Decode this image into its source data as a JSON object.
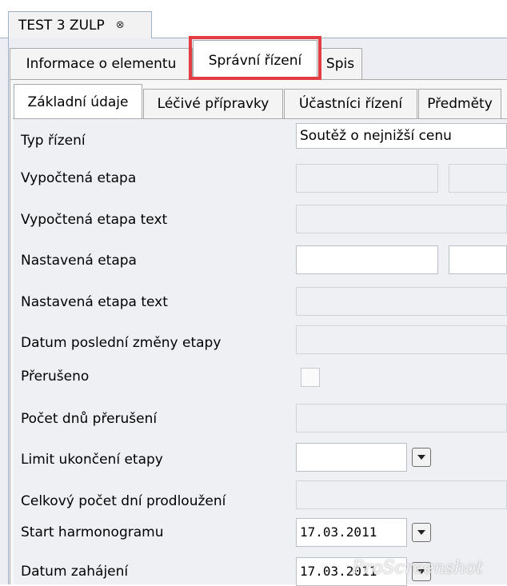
{
  "document_tab": {
    "title": "TEST 3 ZULP",
    "close_glyph": "⊗"
  },
  "tabs_main": [
    {
      "label": "Informace o elementu"
    },
    {
      "label": "Správní řízení"
    },
    {
      "label": "Spis"
    }
  ],
  "tabs_sub": [
    {
      "label": "Základní údaje"
    },
    {
      "label": "Léčivé přípravky"
    },
    {
      "label": "Účastníci řízení"
    },
    {
      "label": "Předměty"
    }
  ],
  "form": {
    "typ_rizeni": {
      "label": "Typ řízení",
      "value": "Soutěž o nejnižší cenu"
    },
    "vypoctena_etapa": {
      "label": "Vypočtená etapa",
      "value": ""
    },
    "vypoctena_etapa_text": {
      "label": "Vypočtená etapa text",
      "value": ""
    },
    "nastavena_etapa": {
      "label": "Nastavená etapa",
      "value": ""
    },
    "nastavena_etapa_text": {
      "label": "Nastavená etapa text",
      "value": ""
    },
    "datum_posledni_zmeny": {
      "label": "Datum poslední změny etapy",
      "value": ""
    },
    "preruseno": {
      "label": "Přerušeno",
      "checked": false
    },
    "pocet_dnu_preruseni": {
      "label": "Počet dnů přerušení",
      "value": ""
    },
    "limit_ukonceni": {
      "label": "Limit ukončení etapy",
      "value": ""
    },
    "celkovy_pocet_dni": {
      "label": "Celkový počet dní prodloužení",
      "value": ""
    },
    "start_harmonogramu": {
      "label": "Start harmonogramu",
      "value": "17.03.2011"
    },
    "datum_zahajeni": {
      "label": "Datum zahájení",
      "value": "17.03.2011"
    }
  },
  "watermark": "ProScreenshot",
  "colors": {
    "highlight": "#e33d44",
    "tab_border": "#a9a9a9",
    "content_bg": "#eef0f4"
  }
}
